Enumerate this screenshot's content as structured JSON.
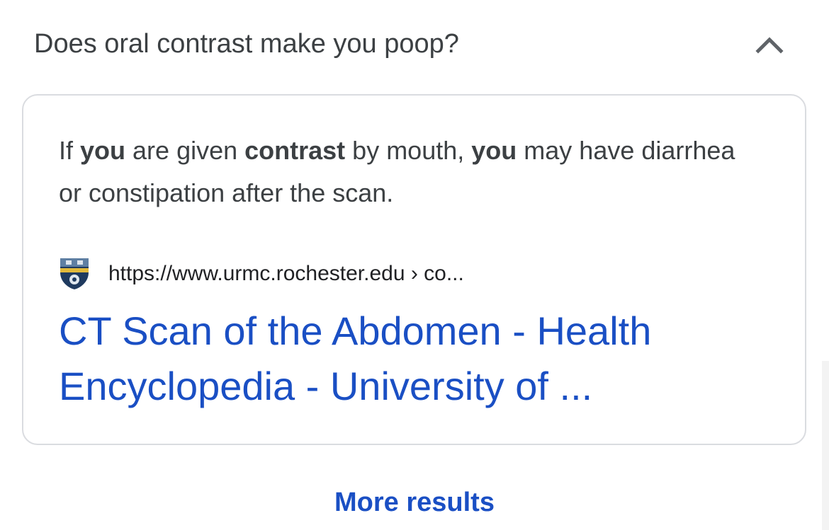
{
  "question": {
    "text": "Does oral contrast make you poop?",
    "toggle_icon": "chevron-up-icon"
  },
  "answer": {
    "snippet_parts": [
      {
        "text": "If ",
        "bold": false
      },
      {
        "text": "you",
        "bold": true
      },
      {
        "text": " are given ",
        "bold": false
      },
      {
        "text": "contrast",
        "bold": true
      },
      {
        "text": " by mouth, ",
        "bold": false
      },
      {
        "text": "you",
        "bold": true
      },
      {
        "text": " may have diarrhea or constipation after the scan.",
        "bold": false
      }
    ],
    "source": {
      "favicon_icon": "university-shield-icon",
      "url": "https://www.urmc.rochester.edu › co..."
    },
    "result_title": "CT Scan of the Abdomen - Health Encyclopedia - University of ..."
  },
  "footer": {
    "more_results_label": "More results"
  },
  "colors": {
    "link_blue": "#1a4fc4",
    "text_dark": "#3c4043",
    "border": "#dadce0"
  }
}
